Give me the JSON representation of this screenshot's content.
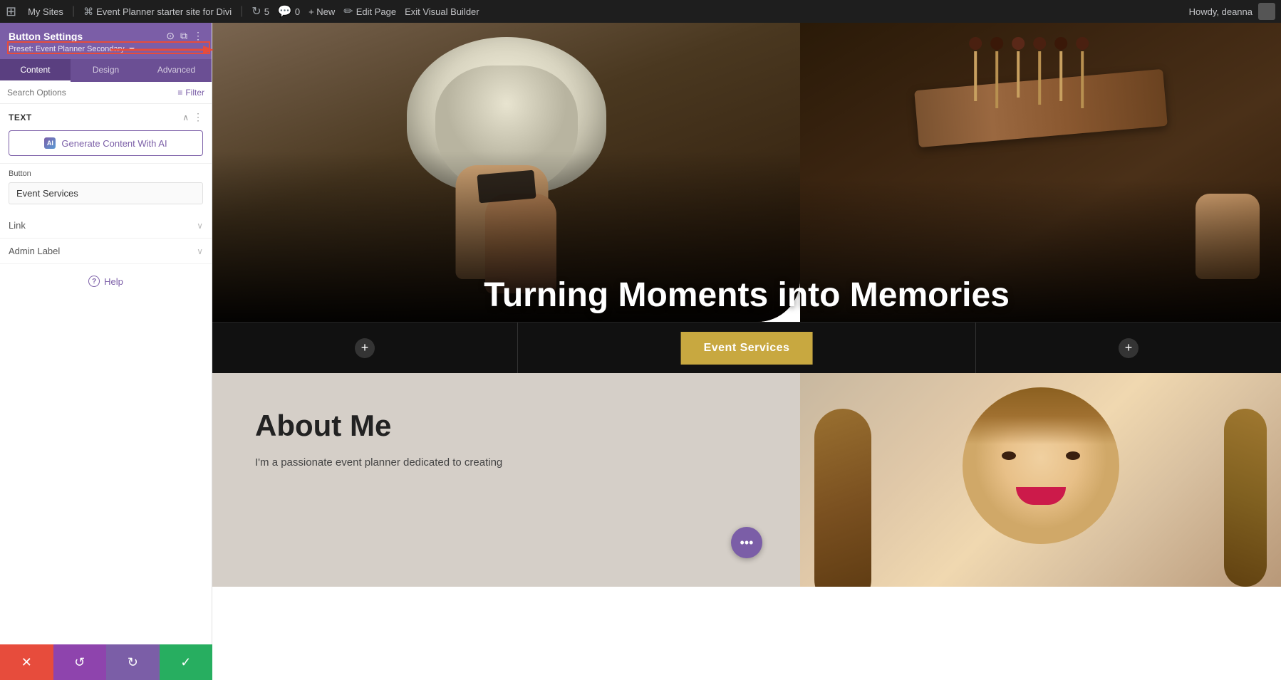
{
  "adminBar": {
    "wpLogo": "⊞",
    "mySites": "My Sites",
    "siteName": "Event Planner starter site for Divi",
    "comments": "5",
    "commentIcon": "💬",
    "commentsCount": "0",
    "newLabel": "+ New",
    "editPage": "Edit Page",
    "exitBuilder": "Exit Visual Builder",
    "howdy": "Howdy, deanna",
    "cornerTag": "event-planner-07"
  },
  "panel": {
    "title": "Button Settings",
    "presetLabel": "Preset: Event Planner Secondary",
    "tabs": [
      {
        "id": "content",
        "label": "Content",
        "active": true
      },
      {
        "id": "design",
        "label": "Design",
        "active": false
      },
      {
        "id": "advanced",
        "label": "Advanced",
        "active": false
      }
    ],
    "searchPlaceholder": "Search Options",
    "filterLabel": "Filter",
    "sections": {
      "text": {
        "title": "Text",
        "aiButton": "Generate Content With AI",
        "buttonLabel": "Button",
        "buttonValue": "Event Services"
      },
      "link": {
        "title": "Link"
      },
      "adminLabel": {
        "title": "Admin Label"
      }
    },
    "helpLabel": "Help"
  },
  "bottomBar": {
    "cancelLabel": "✕",
    "undoLabel": "↺",
    "redoLabel": "↻",
    "saveLabel": "✓"
  },
  "canvas": {
    "heroTitle": "Turning Moments into\nMemories",
    "ctaButton": "Event Services",
    "addButtonLeft": "+",
    "addButtonRight": "+",
    "aboutTitle": "About Me",
    "aboutText": "I'm a passionate event planner dedicated to creating"
  }
}
